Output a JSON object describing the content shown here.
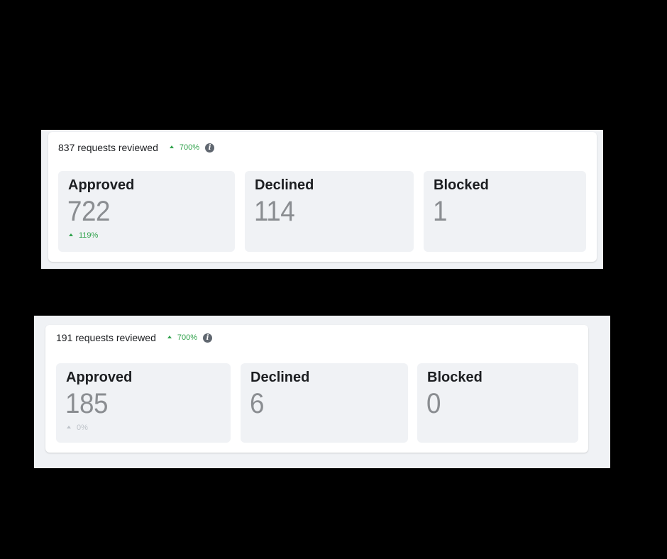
{
  "colors": {
    "background": "#000000",
    "panel_background": "#f0f2f5",
    "card_background": "#ffffff",
    "trend_positive": "#31a24c",
    "trend_neutral": "#bec3c9",
    "value_text": "#8a8d91",
    "info_icon": "#606770"
  },
  "panels": [
    {
      "requests_text": "837 requests reviewed",
      "header_trend": {
        "value": "700%",
        "direction": "up",
        "color": "#31a24c"
      },
      "info_icon": "info-icon",
      "tiles": [
        {
          "label": "Approved",
          "value": "722",
          "trend": {
            "value": "119%",
            "direction": "up",
            "color": "#31a24c"
          }
        },
        {
          "label": "Declined",
          "value": "114"
        },
        {
          "label": "Blocked",
          "value": "1"
        }
      ]
    },
    {
      "requests_text": "191 requests reviewed",
      "header_trend": {
        "value": "700%",
        "direction": "up",
        "color": "#31a24c"
      },
      "info_icon": "info-icon",
      "tiles": [
        {
          "label": "Approved",
          "value": "185",
          "trend": {
            "value": "0%",
            "direction": "up",
            "color": "#bec3c9"
          }
        },
        {
          "label": "Declined",
          "value": "6"
        },
        {
          "label": "Blocked",
          "value": "0"
        }
      ]
    }
  ]
}
